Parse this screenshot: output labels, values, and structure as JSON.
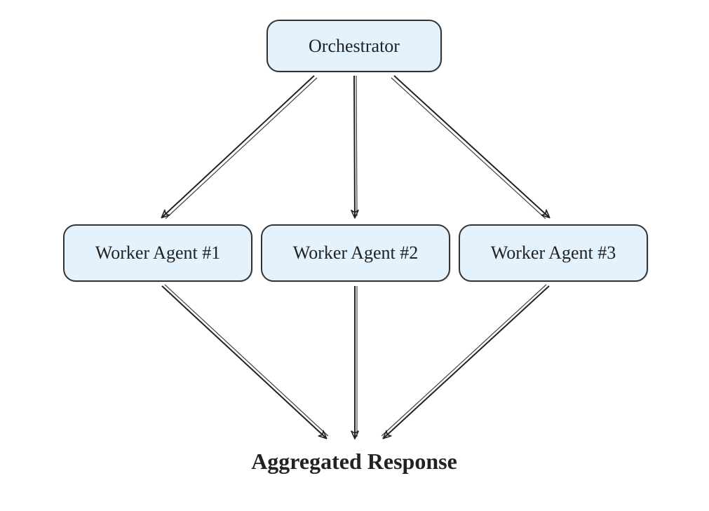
{
  "diagram": {
    "orchestrator": {
      "label": "Orchestrator"
    },
    "workers": [
      {
        "label": "Worker Agent #1"
      },
      {
        "label": "Worker Agent #2"
      },
      {
        "label": "Worker Agent #3"
      }
    ],
    "output": {
      "label": "Aggregated Response"
    }
  }
}
